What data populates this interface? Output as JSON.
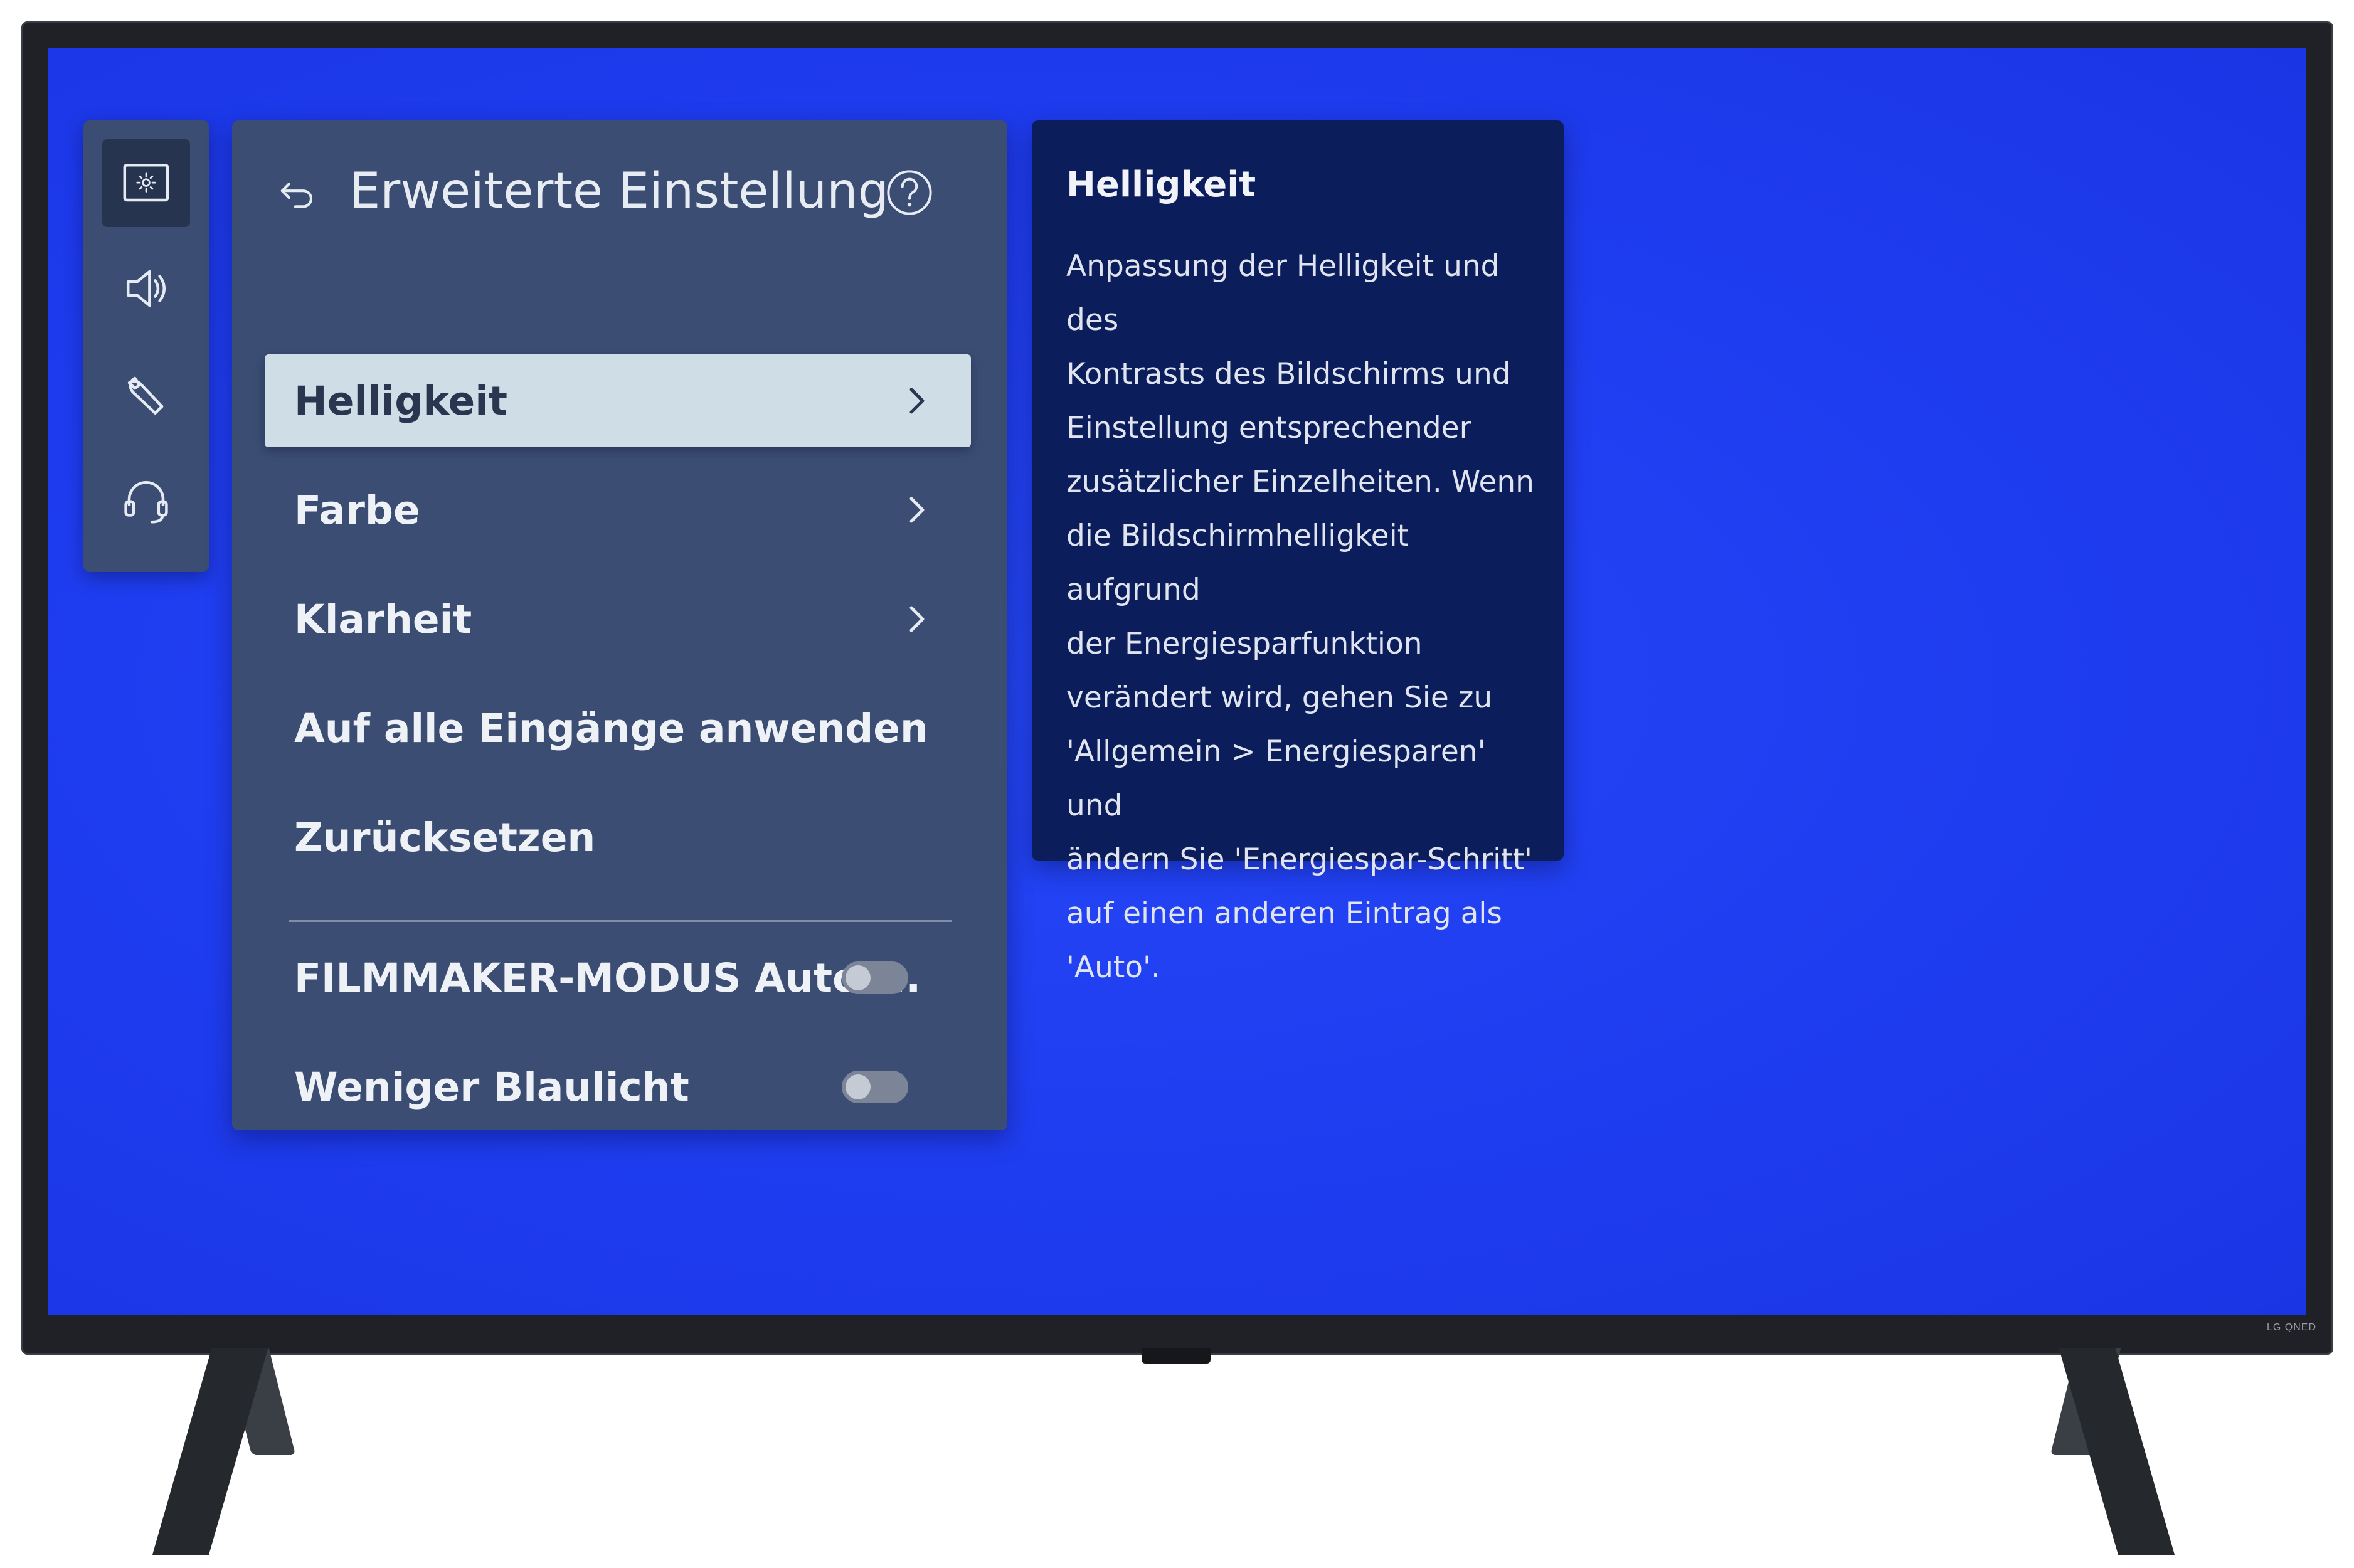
{
  "device": {
    "brand_logo": "LG QNED"
  },
  "sidebar": {
    "items": [
      {
        "icon": "picture-icon",
        "active": true
      },
      {
        "icon": "speaker-icon",
        "active": false
      },
      {
        "icon": "wrench-icon",
        "active": false
      },
      {
        "icon": "headset-icon",
        "active": false
      }
    ]
  },
  "panel": {
    "title": "Erweiterte Einstellung",
    "back_icon": "back-arrow-icon",
    "help_icon": "help-icon",
    "menu": [
      {
        "label": "Helligkeit",
        "has_submenu": true,
        "focused": true
      },
      {
        "label": "Farbe",
        "has_submenu": true,
        "focused": false
      },
      {
        "label": "Klarheit",
        "has_submenu": true,
        "focused": false
      },
      {
        "label": "Auf alle Eingänge anwenden",
        "has_submenu": false,
        "focused": false
      },
      {
        "label": "Zurücksetzen",
        "has_submenu": false,
        "focused": false
      }
    ],
    "toggles": [
      {
        "label": "FILMMAKER-MODUS Auto-...",
        "state": "off"
      },
      {
        "label": "Weniger Blaulicht",
        "state": "off"
      }
    ]
  },
  "info": {
    "title": "Helligkeit",
    "lines": [
      "Anpassung der Helligkeit und des",
      "Kontrasts des Bildschirms und",
      "Einstellung entsprechender",
      "zusätzlicher Einzelheiten. Wenn",
      "die Bildschirmhelligkeit aufgrund",
      "der Energiesparfunktion",
      "verändert wird, gehen Sie zu",
      "'Allgemein > Energiesparen' und",
      "ändern Sie 'Energiespar-Schritt'",
      "auf einen anderen Eintrag als",
      "'Auto'."
    ]
  },
  "colors": {
    "screen_background": "#1f3df0",
    "panel_background": "#3b4d73",
    "info_background": "#0c1d5c",
    "focus_highlight": "#cfdde6"
  }
}
